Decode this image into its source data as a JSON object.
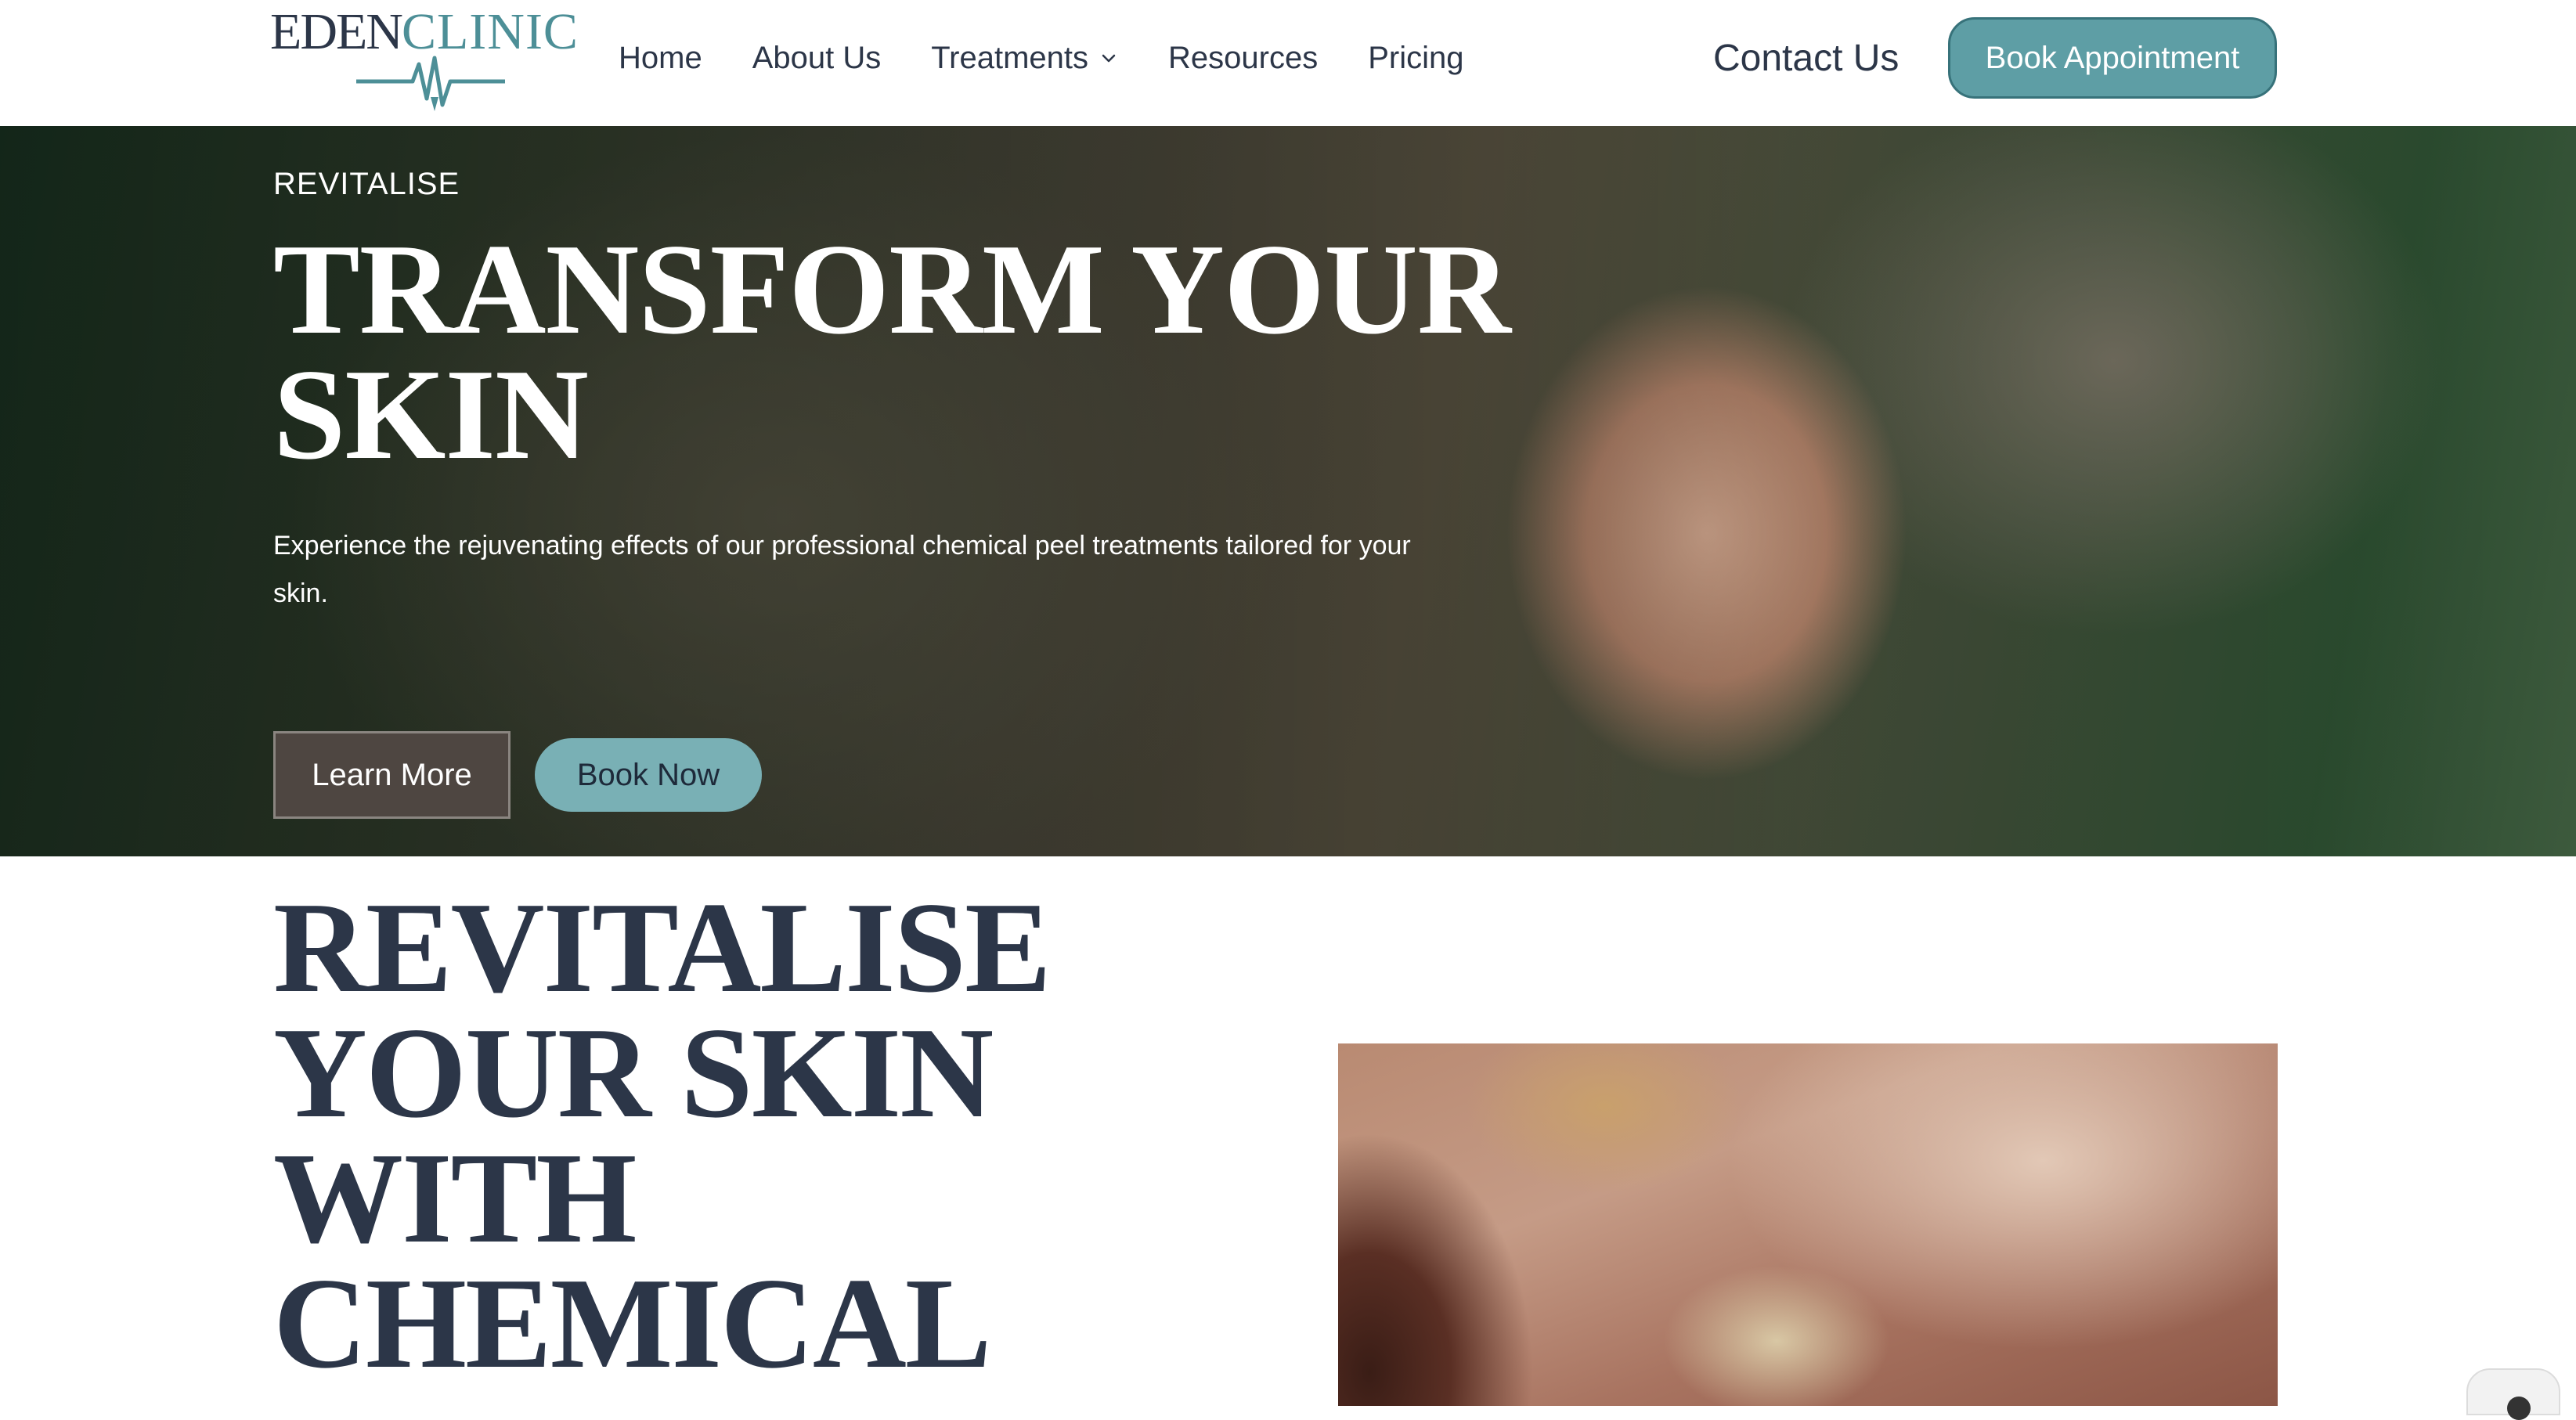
{
  "brand": {
    "logo_primary": "EDEN",
    "logo_secondary": "CLINIC",
    "logo_color": "#4d8f97"
  },
  "nav": {
    "items": [
      {
        "label": "Home"
      },
      {
        "label": "About Us"
      },
      {
        "label": "Treatments",
        "icon": "chevron-down-icon"
      },
      {
        "label": "Resources"
      },
      {
        "label": "Pricing"
      }
    ],
    "contact_label": "Contact Us",
    "cta_label": "Book Appointment"
  },
  "hero": {
    "eyebrow": "REVITALISE",
    "title": "TRANSFORM YOUR SKIN",
    "description": "Experience the rejuvenating effects of our professional chemical peel treatments tailored for your skin.",
    "primary_button": "Learn More",
    "secondary_button": "Book Now"
  },
  "section": {
    "title": "REVITALISE YOUR SKIN WITH CHEMICAL"
  },
  "colors": {
    "accent": "#5e9ea5",
    "text_dark": "#2c3648",
    "button_light": "#79b0b5"
  }
}
